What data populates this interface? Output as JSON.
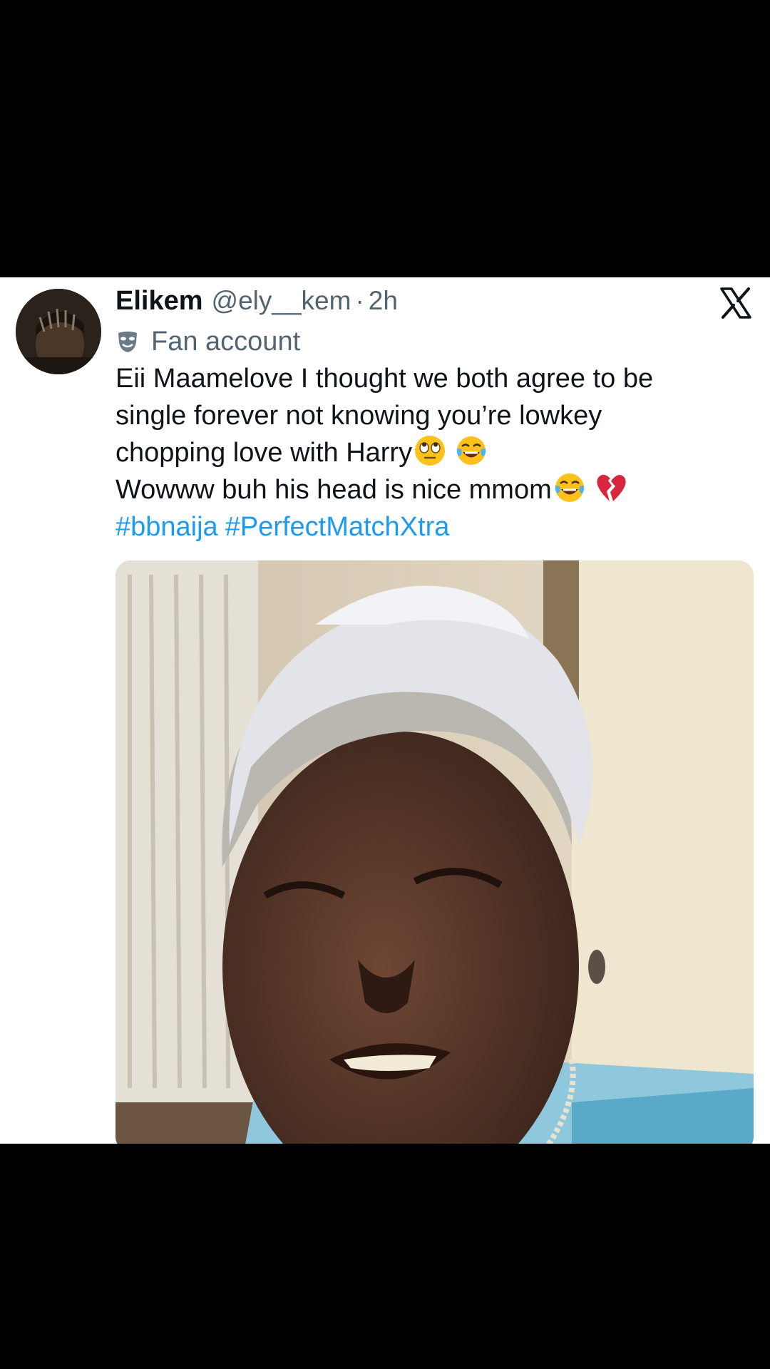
{
  "tweet": {
    "display_name": "Elikem",
    "handle": "@ely__kem",
    "separator": "·",
    "time": "2h",
    "badge_label": "Fan account",
    "text_lines": [
      "Eii Maamelove I thought we both agree to be",
      "single forever not knowing you’re lowkey",
      "chopping love with Harry",
      "Wowww buh his head is nice mmom"
    ],
    "line3_emojis": [
      "eye-roll-emoji",
      "tears-of-joy-emoji"
    ],
    "line4_emojis": [
      "tears-of-joy-emoji",
      "broken-heart-emoji"
    ],
    "hashtags": [
      "#bbnaija",
      "#PerfectMatchXtra"
    ],
    "hashtag_color": "#1d9bf0",
    "platform_icon": "x-logo-icon"
  },
  "media": {
    "kind": "photo",
    "icon": "photo-of-elderly-woman"
  }
}
